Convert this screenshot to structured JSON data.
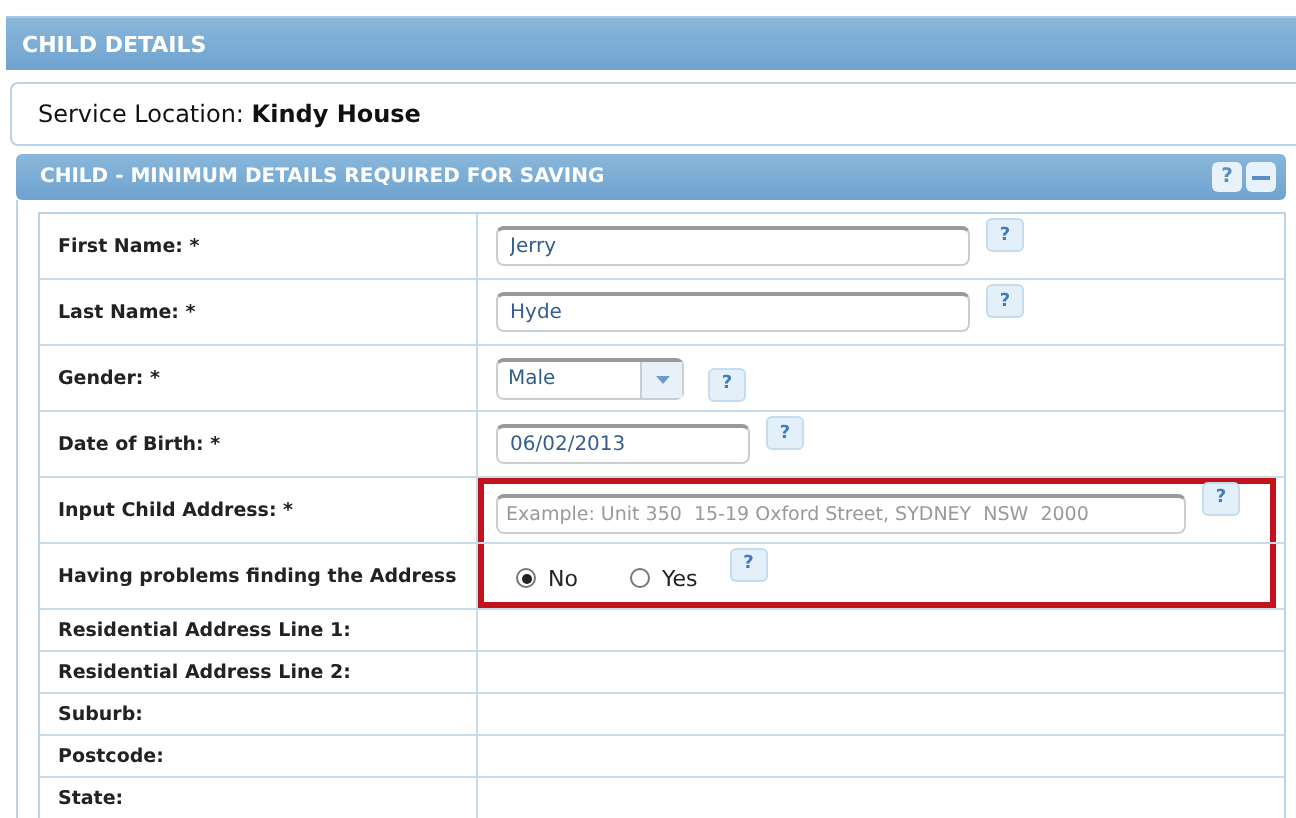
{
  "panel": {
    "title": "CHILD DETAILS"
  },
  "service_location": {
    "label": "Service Location:",
    "value": "Kindy House"
  },
  "section": {
    "title": "CHILD - MINIMUM DETAILS REQUIRED FOR SAVING",
    "help": "?",
    "collapsed": false
  },
  "rows": [
    {
      "kind": "text",
      "label": "First Name: *",
      "value": "Jerry",
      "help": "?",
      "highlighted": false
    },
    {
      "kind": "text",
      "label": "Last Name: *",
      "value": "Hyde",
      "help": "?",
      "highlighted": false
    },
    {
      "kind": "select",
      "label": "Gender: *",
      "value": "Male",
      "help": "?",
      "highlighted": false
    },
    {
      "kind": "date",
      "label": "Date of Birth: *",
      "value": "06/02/2013",
      "help": "?",
      "highlighted": false
    },
    {
      "kind": "address",
      "label": "Input Child Address: *",
      "placeholder": "Example: Unit 350  15-19 Oxford Street, SYDNEY  NSW  2000",
      "help": "?",
      "highlighted": true
    },
    {
      "kind": "radio",
      "label": "Having problems finding the Address",
      "options": [
        {
          "label": "No",
          "selected": true
        },
        {
          "label": "Yes",
          "selected": false
        }
      ],
      "help": "?",
      "highlighted": true
    },
    {
      "kind": "empty",
      "label": "Residential Address Line 1:",
      "highlighted": false
    },
    {
      "kind": "empty",
      "label": "Residential Address Line 2:",
      "highlighted": false
    },
    {
      "kind": "empty",
      "label": "Suburb:",
      "highlighted": false
    },
    {
      "kind": "empty",
      "label": "Postcode:",
      "highlighted": false
    },
    {
      "kind": "empty",
      "label": "State:",
      "highlighted": false
    }
  ]
}
